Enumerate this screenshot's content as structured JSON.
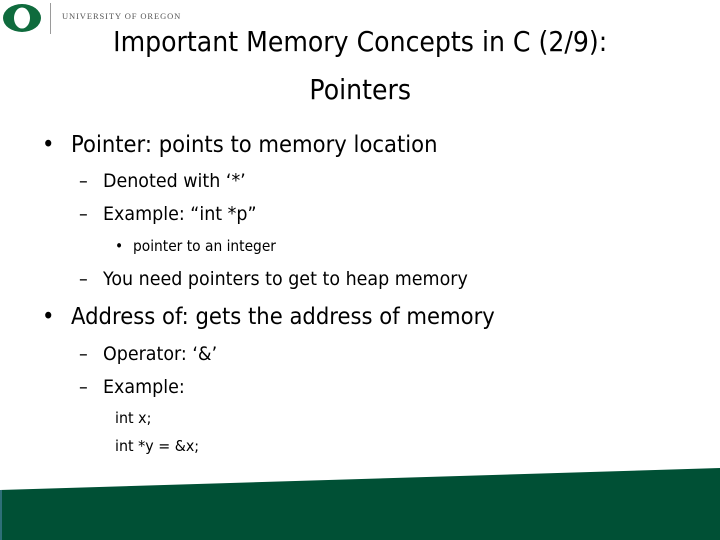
{
  "header": {
    "logo_letter": "O",
    "institution": "UNIVERSITY OF OREGON",
    "brand_color": "#0f6b3d"
  },
  "slide": {
    "title_line1": "Important Memory Concepts in C (2/9):",
    "title_line2": "Pointers",
    "bullets": [
      {
        "marker": "•",
        "text": "Pointer: points to memory location",
        "children": [
          {
            "marker": "–",
            "text": "Denoted with ‘*’"
          },
          {
            "marker": "–",
            "text": "Example: “int *p”",
            "children": [
              {
                "marker": "•",
                "text": "pointer to an integer"
              }
            ]
          },
          {
            "marker": "–",
            "text": "You need pointers to get to heap memory"
          }
        ]
      },
      {
        "marker": "•",
        "text": "Address of: gets the address of memory",
        "children": [
          {
            "marker": "–",
            "text": "Operator: ‘&’"
          },
          {
            "marker": "–",
            "text": "Example:"
          }
        ],
        "code_lines": [
          "int x;",
          "int *y = &x;"
        ]
      }
    ]
  },
  "footer": {
    "band_color": "#005035"
  }
}
